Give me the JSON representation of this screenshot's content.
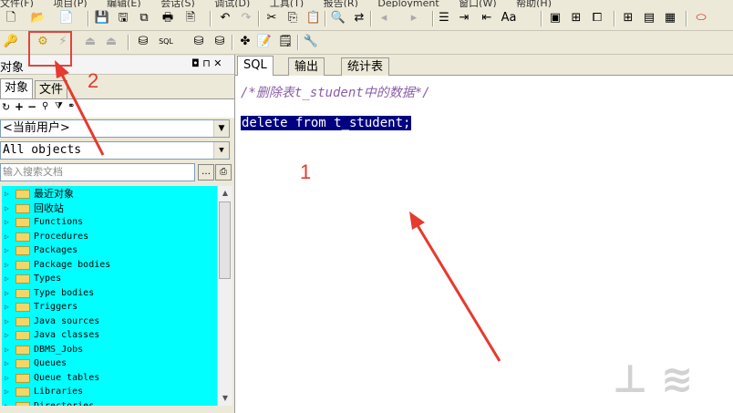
{
  "menubar": {
    "items": [
      "文件(F)",
      "项目(P)",
      "编辑(E)",
      "会话(S)",
      "调试(D)",
      "工具(T)",
      "报告(R)",
      "Deployment",
      "窗口(W)",
      "帮助(H)"
    ]
  },
  "toolbar1": {
    "icons": [
      "new-icon",
      "open-icon",
      "print-preview-icon",
      "save-icon",
      "save-all-icon",
      "copy-icon",
      "print-icon",
      "undo-icon",
      "redo-icon",
      "cut-icon",
      "copy-clip-icon",
      "paste-icon",
      "find-icon",
      "replace-icon",
      "back-icon",
      "forward-icon",
      "comment-icon",
      "indent-icon",
      "outdent-icon",
      "window-icon",
      "tile-icon",
      "grid-icon",
      "oracle-icon"
    ]
  },
  "toolbar2": {
    "icons": [
      "search-icon",
      "execute-icon",
      "break-icon",
      "commit-icon",
      "rollback-icon",
      "connect-icon",
      "sql-icon",
      "session-icon",
      "explain-icon",
      "bookmark-icon",
      "template-icon",
      "wrench-icon"
    ]
  },
  "left_panel": {
    "title": "对象",
    "pin_controls": "◘ ⊓ ✕",
    "tabs": [
      "对象",
      "文件"
    ],
    "user_combo": "<当前用户>",
    "objects_combo": "All objects",
    "search_placeholder": "输入搜索文档",
    "tree": [
      {
        "label": "最近对象",
        "cn": true
      },
      {
        "label": "回收站",
        "cn": true
      },
      {
        "label": "Functions",
        "cn": false
      },
      {
        "label": "Procedures",
        "cn": false
      },
      {
        "label": "Packages",
        "cn": false
      },
      {
        "label": "Package bodies",
        "cn": false
      },
      {
        "label": "Types",
        "cn": false
      },
      {
        "label": "Type bodies",
        "cn": false
      },
      {
        "label": "Triggers",
        "cn": false
      },
      {
        "label": "Java sources",
        "cn": false
      },
      {
        "label": "Java classes",
        "cn": false
      },
      {
        "label": "DBMS_Jobs",
        "cn": false
      },
      {
        "label": "Queues",
        "cn": false
      },
      {
        "label": "Queue tables",
        "cn": false
      },
      {
        "label": "Libraries",
        "cn": false
      },
      {
        "label": "Directories",
        "cn": false
      }
    ]
  },
  "editor": {
    "tabs": [
      "SQL",
      "输出",
      "统计表"
    ],
    "comment_line": "/*删除表t_student中的数据*/",
    "selected_line": "delete from t_student;"
  },
  "annotations": {
    "label_1": "1",
    "label_2": "2"
  },
  "colors": {
    "tree_bg": "#00ffff",
    "selection_bg": "#000080",
    "annotation_red": "#e53a2f"
  }
}
